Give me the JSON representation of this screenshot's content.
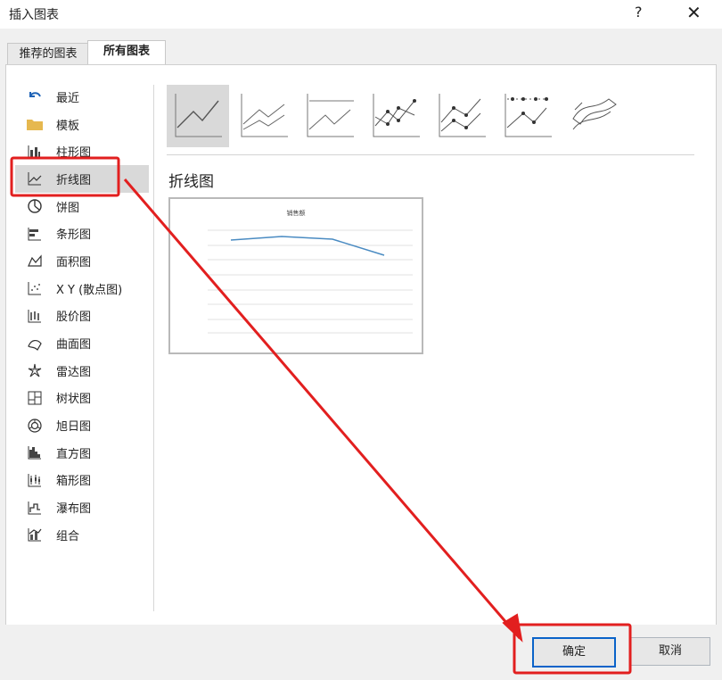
{
  "window": {
    "title": "插入图表",
    "help": "?",
    "close": "✕"
  },
  "tabs": [
    {
      "label": "推荐的图表"
    },
    {
      "label": "所有图表"
    }
  ],
  "sidebar": {
    "items": [
      {
        "label": "最近",
        "icon": "undo-arrow-icon"
      },
      {
        "label": "模板",
        "icon": "folder-icon"
      },
      {
        "label": "柱形图",
        "icon": "column-chart-icon"
      },
      {
        "label": "折线图",
        "icon": "line-chart-icon"
      },
      {
        "label": "饼图",
        "icon": "pie-chart-icon"
      },
      {
        "label": "条形图",
        "icon": "bar-chart-icon"
      },
      {
        "label": "面积图",
        "icon": "area-chart-icon"
      },
      {
        "label": "X Y (散点图)",
        "icon": "scatter-chart-icon"
      },
      {
        "label": "股价图",
        "icon": "stock-chart-icon"
      },
      {
        "label": "曲面图",
        "icon": "surface-chart-icon"
      },
      {
        "label": "雷达图",
        "icon": "radar-chart-icon"
      },
      {
        "label": "树状图",
        "icon": "treemap-chart-icon"
      },
      {
        "label": "旭日图",
        "icon": "sunburst-chart-icon"
      },
      {
        "label": "直方图",
        "icon": "histogram-chart-icon"
      },
      {
        "label": "箱形图",
        "icon": "box-whisker-chart-icon"
      },
      {
        "label": "瀑布图",
        "icon": "waterfall-chart-icon"
      },
      {
        "label": "组合",
        "icon": "combo-chart-icon"
      }
    ],
    "selected": "折线图"
  },
  "main": {
    "subtitle": "折线图",
    "preview_title": "销售额"
  },
  "footer": {
    "ok_label": "确定",
    "cancel_label": "取消"
  },
  "colors": {
    "accent": "#0a63c9",
    "annotation": "#e21f1f",
    "selected_bg": "#d9d9d9",
    "preview_line": "#4a8bc2"
  }
}
